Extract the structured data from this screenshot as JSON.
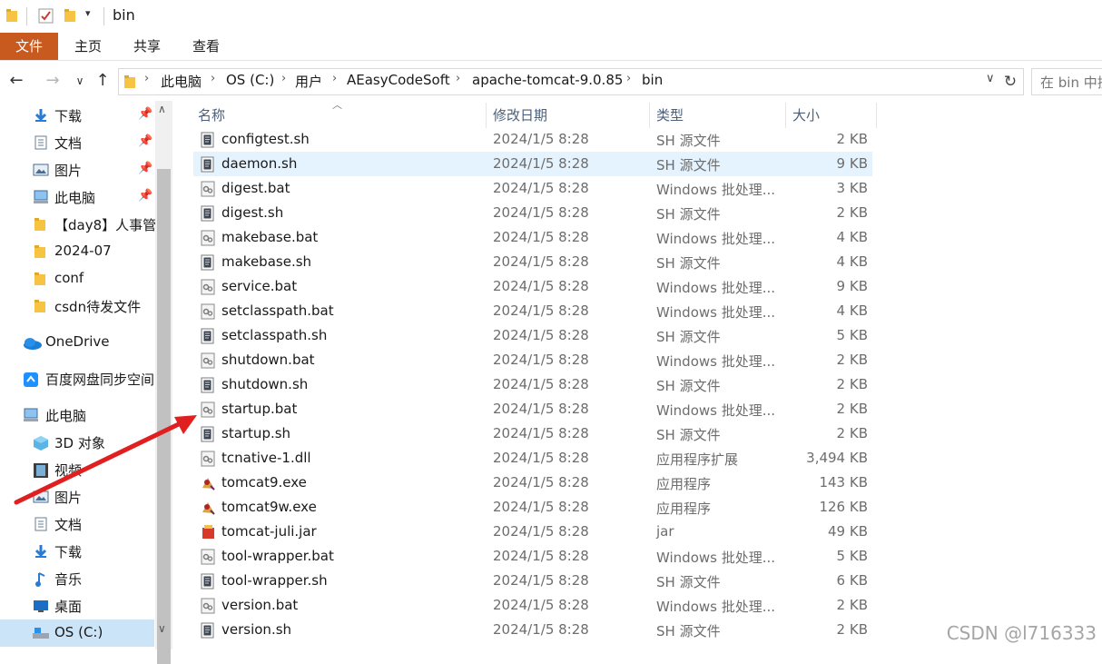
{
  "window": {
    "title": "bin"
  },
  "ribbon": {
    "file_tab": "文件",
    "tabs": [
      "主页",
      "共享",
      "查看"
    ]
  },
  "address": {
    "breadcrumbs": [
      "此电脑",
      "OS (C:)",
      "用户",
      "AEasyCodeSoft",
      "apache-tomcat-9.0.85",
      "bin"
    ],
    "search_placeholder": "在 bin 中搜索"
  },
  "nav_pane": {
    "quick_access": [
      {
        "label": "下载",
        "icon": "download-icon",
        "pinned": true
      },
      {
        "label": "文档",
        "icon": "document-icon",
        "pinned": true
      },
      {
        "label": "图片",
        "icon": "pictures-icon",
        "pinned": true
      },
      {
        "label": "此电脑",
        "icon": "computer-icon",
        "pinned": true
      },
      {
        "label": "【day8】人事管",
        "icon": "folder-icon",
        "pinned": false
      },
      {
        "label": "2024-07",
        "icon": "folder-icon",
        "pinned": false
      },
      {
        "label": "conf",
        "icon": "folder-icon",
        "pinned": false
      },
      {
        "label": "csdn待发文件",
        "icon": "folder-icon",
        "pinned": false
      }
    ],
    "onedrive": "OneDrive",
    "baidu": "百度网盘同步空间",
    "this_pc": "此电脑",
    "this_pc_items": [
      {
        "label": "3D 对象",
        "icon": "3d-objects-icon"
      },
      {
        "label": "视频",
        "icon": "video-icon"
      },
      {
        "label": "图片",
        "icon": "pictures-icon"
      },
      {
        "label": "文档",
        "icon": "document-icon"
      },
      {
        "label": "下载",
        "icon": "download-icon"
      },
      {
        "label": "音乐",
        "icon": "music-icon"
      },
      {
        "label": "桌面",
        "icon": "desktop-icon"
      },
      {
        "label": "OS (C:)",
        "icon": "drive-icon"
      }
    ]
  },
  "columns": {
    "name": "名称",
    "date": "修改日期",
    "type": "类型",
    "size": "大小"
  },
  "files": [
    {
      "name": "configtest.sh",
      "date": "2024/1/5 8:28",
      "type": "SH 源文件",
      "size": "2 KB",
      "icon": "sh-file-icon"
    },
    {
      "name": "daemon.sh",
      "date": "2024/1/5 8:28",
      "type": "SH 源文件",
      "size": "9 KB",
      "icon": "sh-file-icon",
      "selected": true
    },
    {
      "name": "digest.bat",
      "date": "2024/1/5 8:28",
      "type": "Windows 批处理...",
      "size": "3 KB",
      "icon": "bat-file-icon"
    },
    {
      "name": "digest.sh",
      "date": "2024/1/5 8:28",
      "type": "SH 源文件",
      "size": "2 KB",
      "icon": "sh-file-icon"
    },
    {
      "name": "makebase.bat",
      "date": "2024/1/5 8:28",
      "type": "Windows 批处理...",
      "size": "4 KB",
      "icon": "bat-file-icon"
    },
    {
      "name": "makebase.sh",
      "date": "2024/1/5 8:28",
      "type": "SH 源文件",
      "size": "4 KB",
      "icon": "sh-file-icon"
    },
    {
      "name": "service.bat",
      "date": "2024/1/5 8:28",
      "type": "Windows 批处理...",
      "size": "9 KB",
      "icon": "bat-file-icon"
    },
    {
      "name": "setclasspath.bat",
      "date": "2024/1/5 8:28",
      "type": "Windows 批处理...",
      "size": "4 KB",
      "icon": "bat-file-icon"
    },
    {
      "name": "setclasspath.sh",
      "date": "2024/1/5 8:28",
      "type": "SH 源文件",
      "size": "5 KB",
      "icon": "sh-file-icon"
    },
    {
      "name": "shutdown.bat",
      "date": "2024/1/5 8:28",
      "type": "Windows 批处理...",
      "size": "2 KB",
      "icon": "bat-file-icon"
    },
    {
      "name": "shutdown.sh",
      "date": "2024/1/5 8:28",
      "type": "SH 源文件",
      "size": "2 KB",
      "icon": "sh-file-icon"
    },
    {
      "name": "startup.bat",
      "date": "2024/1/5 8:28",
      "type": "Windows 批处理...",
      "size": "2 KB",
      "icon": "bat-file-icon"
    },
    {
      "name": "startup.sh",
      "date": "2024/1/5 8:28",
      "type": "SH 源文件",
      "size": "2 KB",
      "icon": "sh-file-icon"
    },
    {
      "name": "tcnative-1.dll",
      "date": "2024/1/5 8:28",
      "type": "应用程序扩展",
      "size": "3,494 KB",
      "icon": "dll-file-icon"
    },
    {
      "name": "tomcat9.exe",
      "date": "2024/1/5 8:28",
      "type": "应用程序",
      "size": "143 KB",
      "icon": "tomcat-exe-icon"
    },
    {
      "name": "tomcat9w.exe",
      "date": "2024/1/5 8:28",
      "type": "应用程序",
      "size": "126 KB",
      "icon": "tomcat-exe-icon"
    },
    {
      "name": "tomcat-juli.jar",
      "date": "2024/1/5 8:28",
      "type": "jar",
      "size": "49 KB",
      "icon": "jar-file-icon"
    },
    {
      "name": "tool-wrapper.bat",
      "date": "2024/1/5 8:28",
      "type": "Windows 批处理...",
      "size": "5 KB",
      "icon": "bat-file-icon"
    },
    {
      "name": "tool-wrapper.sh",
      "date": "2024/1/5 8:28",
      "type": "SH 源文件",
      "size": "6 KB",
      "icon": "sh-file-icon"
    },
    {
      "name": "version.bat",
      "date": "2024/1/5 8:28",
      "type": "Windows 批处理...",
      "size": "2 KB",
      "icon": "bat-file-icon"
    },
    {
      "name": "version.sh",
      "date": "2024/1/5 8:28",
      "type": "SH 源文件",
      "size": "2 KB",
      "icon": "sh-file-icon"
    }
  ],
  "watermark": "CSDN @l716333",
  "colors": {
    "file_tab": "#c85a1f",
    "selected_row": "#e5f3ff",
    "annotation_arrow": "#e02020",
    "folder": "#f6c343"
  }
}
